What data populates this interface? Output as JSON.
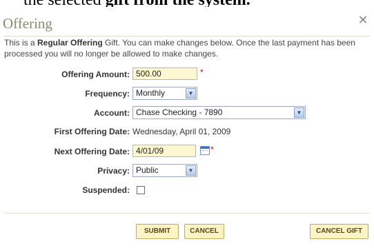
{
  "caption": {
    "prefix": "the selected ",
    "bold": "gift from the system."
  },
  "dialog": {
    "title": "Offering",
    "close_glyph": "✕",
    "intro": {
      "part1": "This is a ",
      "bold": "Regular Offering",
      "part2": " Gift. You can make changes below. Once the last payment has been processed you will no longer be allowed to make changes."
    }
  },
  "form": {
    "amount": {
      "label": "Offering Amount:",
      "value": "500.00",
      "required": "*"
    },
    "frequency": {
      "label": "Frequency:",
      "value": "Monthly"
    },
    "account": {
      "label": "Account:",
      "value": "Chase Checking - 7890"
    },
    "first_date": {
      "label": "First Offering Date:",
      "value": "Wednesday, April 01, 2009"
    },
    "next_date": {
      "label": "Next Offering Date:",
      "value": "4/01/09",
      "required": "*"
    },
    "privacy": {
      "label": "Privacy:",
      "value": "Public"
    },
    "suspended": {
      "label": "Suspended:",
      "checked": false
    }
  },
  "buttons": {
    "submit": "SUBMIT",
    "cancel": "CANCEL",
    "cancel_gift": "CANCEL GIFT"
  },
  "icons": {
    "select_arrow": "chevron-down-icon",
    "calendar": "calendar-icon",
    "close": "close-icon"
  },
  "colors": {
    "input_bg": "#fdf8d2",
    "button_bg": "#fdf4c6",
    "required": "#cc0000",
    "title": "#8a8a70"
  }
}
